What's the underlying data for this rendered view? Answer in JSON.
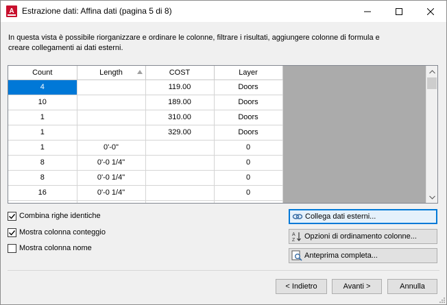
{
  "window": {
    "title": "Estrazione dati: Affina dati (pagina 5 di 8)"
  },
  "description": "In questa vista è possibile riorganizzare e ordinare le colonne, filtrare i risultati, aggiungere colonne di formula e creare collegamenti ai dati esterni.",
  "grid": {
    "columns": [
      "Count",
      "Length",
      "COST",
      "Layer"
    ],
    "rows": [
      [
        "4",
        "",
        "119.00",
        "Doors"
      ],
      [
        "10",
        "",
        "189.00",
        "Doors"
      ],
      [
        "1",
        "",
        "310.00",
        "Doors"
      ],
      [
        "1",
        "",
        "329.00",
        "Doors"
      ],
      [
        "1",
        "0'-0\"",
        "",
        "0"
      ],
      [
        "8",
        "0'-0 1/4\"",
        "",
        "0"
      ],
      [
        "8",
        "0'-0 1/4\"",
        "",
        "0"
      ],
      [
        "16",
        "0'-0 1/4\"",
        "",
        "0"
      ]
    ]
  },
  "options": {
    "combine_rows": {
      "label": "Combina righe identiche",
      "checked": true
    },
    "show_count": {
      "label": "Mostra colonna conteggio",
      "checked": true
    },
    "show_name": {
      "label": "Mostra colonna nome",
      "checked": false
    }
  },
  "actions": {
    "link_external": "Collega dati esterni...",
    "sort_options": "Opzioni di ordinamento colonne...",
    "full_preview": "Anteprima completa..."
  },
  "footer": {
    "back": "< Indietro",
    "next": "Avanti >",
    "cancel": "Annulla"
  },
  "colors": {
    "accent": "#0078d7",
    "app_icon": "#c8102e"
  }
}
